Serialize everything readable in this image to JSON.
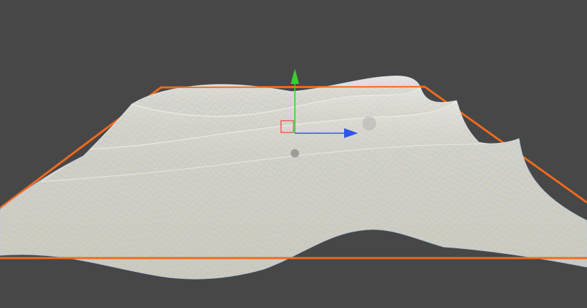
{
  "scene": {
    "background_color": "#474747",
    "object": {
      "type": "terrain-mesh",
      "surface_color": "#d8d4c6",
      "wireframe_color": "#9eb7d8",
      "selected": true,
      "selection_outline_color": "#f26a1b"
    },
    "gizmo": {
      "type": "move-tool",
      "y_axis_color": "#38d12b",
      "x_axis_color": "#2f55ea",
      "center_handle_color": "#e45a4b",
      "handle_colors": [
        "#8d8d8d",
        "#aaaaaa"
      ]
    }
  }
}
